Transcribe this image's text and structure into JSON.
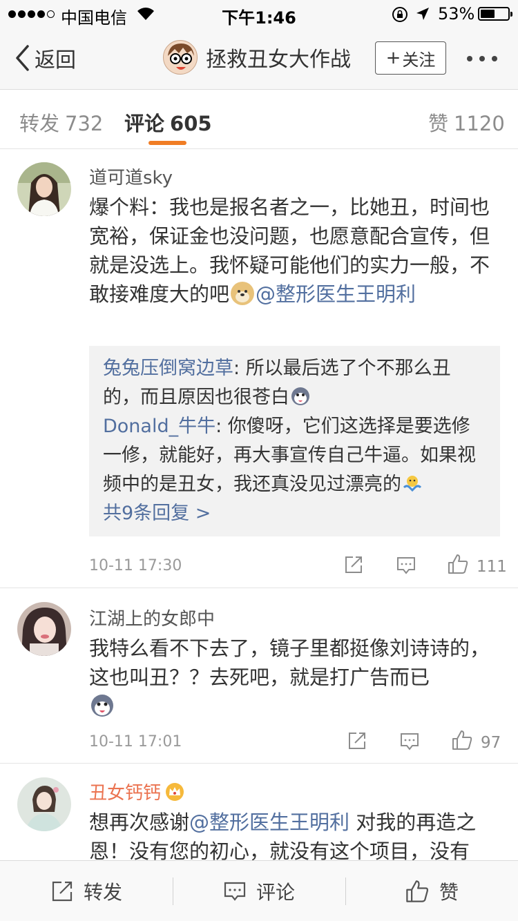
{
  "status_bar": {
    "carrier": "中国电信",
    "time": "下午1:46",
    "battery_percent": "53%",
    "battery_level": 0.53
  },
  "nav": {
    "back_label": "返回",
    "title": "拯救丑女大作战",
    "follow_label": "关注",
    "follow_plus": "+"
  },
  "tabs": [
    {
      "label": "转发",
      "count": "732"
    },
    {
      "label": "评论",
      "count": "605"
    },
    {
      "label": "赞",
      "count": "1120"
    }
  ],
  "comments": [
    {
      "author": "道可道sky",
      "text_before": "爆个料：我也是报名者之一，比她丑，时间也宽裕，保证金也没问题，也愿意配合宣传，但就是没选上。我怀疑可能他们的实力一般，不敢接难度大的吧",
      "mention": "@整形医生王明利",
      "replies": [
        {
          "author": "兔兔压倒窝边草",
          "sep": ": ",
          "text": "所以最后选了个不那么丑的，而且原因也很苍白"
        },
        {
          "author": "Donald_牛牛",
          "sep": ": ",
          "text": "你傻呀，它们这选择是要选修一修，就能好，再大事宣传自己牛逼。如果视频中的是丑女，我还真没见过漂亮的"
        }
      ],
      "more_replies": "共9条回复 >",
      "time": "10-11 17:30",
      "likes": "111"
    },
    {
      "author": "江湖上的女郎中",
      "text": "我特么看不下去了，镜子里都挺像刘诗诗的，这也叫丑？？去死吧，就是打广告而已",
      "time": "10-11 17:01",
      "likes": "97"
    },
    {
      "author": "丑女钙钙",
      "text_before": "想再次感谢",
      "mention": "@整形医生王明利",
      "text_after": " 对我的再造之恩！没有您的初心，就没有这个项目，没有"
    }
  ],
  "bottom_bar": {
    "repost_label": "转发",
    "comment_label": "评论",
    "like_label": "赞"
  },
  "colors": {
    "accent": "#f07d25",
    "link": "#526f9f",
    "vip_name": "#eb7350"
  },
  "icons": [
    "signal-dots-icon",
    "wifi-icon",
    "rotation-lock-icon",
    "location-arrow-icon",
    "battery-icon",
    "back-chevron-icon",
    "more-dots-icon",
    "share-icon",
    "comment-icon",
    "like-icon",
    "crown-icon",
    "doge-emoji",
    "husky-emoji",
    "shrug-emoji"
  ]
}
